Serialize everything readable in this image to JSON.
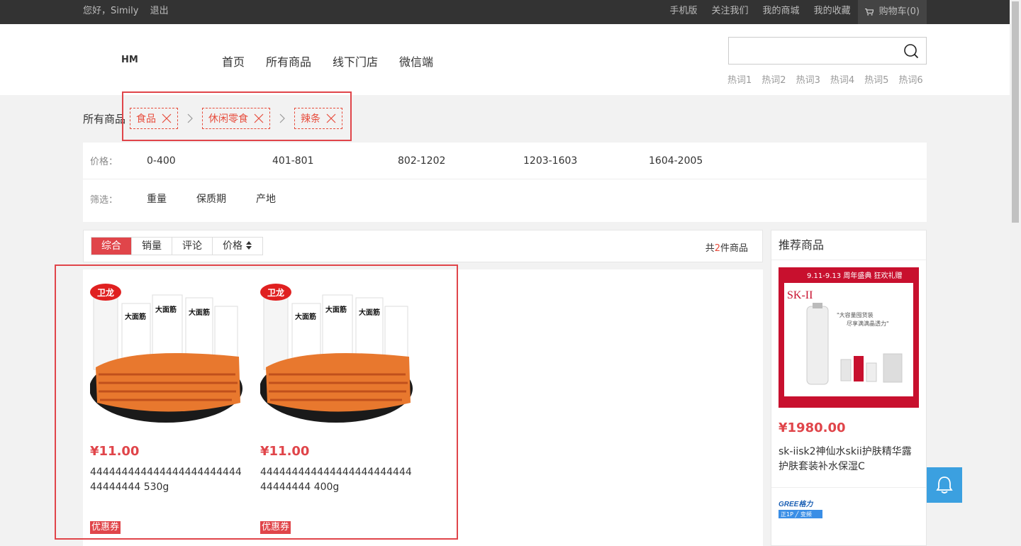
{
  "topbar": {
    "greeting": "您好，Simily",
    "logout": "退出",
    "links": [
      "手机版",
      "关注我们",
      "我的商城",
      "我的收藏"
    ],
    "cart": "购物车(0)"
  },
  "header": {
    "logo": "HM",
    "nav": [
      "首页",
      "所有商品",
      "线下门店",
      "微信端"
    ],
    "search_placeholder": "",
    "hotwords": [
      "热词1",
      "热词2",
      "热词3",
      "热词4",
      "热词5",
      "热词6"
    ]
  },
  "breadcrumb": {
    "root": "所有商品",
    "tags": [
      "食品",
      "休闲零食",
      "辣条"
    ]
  },
  "filter": {
    "price_label": "价格：",
    "prices": [
      "0-400",
      "401-801",
      "802-1202",
      "1203-1603",
      "1604-2005"
    ],
    "select_label": "筛选：",
    "selects": [
      "重量",
      "保质期",
      "产地"
    ]
  },
  "sortbar": {
    "sorts": [
      "综合",
      "销量",
      "评论",
      "价格"
    ],
    "count_prefix": "共",
    "count": "2",
    "count_suffix": "件商品"
  },
  "products": [
    {
      "price": "¥11.00",
      "name": "44444444444444444444444444444444 530g",
      "coupon": "优惠券"
    },
    {
      "price": "¥11.00",
      "name": "44444444444444444444444444444444 400g",
      "coupon": "优惠券"
    }
  ],
  "recommend": {
    "title": "推荐商品",
    "items": [
      {
        "price": "¥1980.00",
        "name": "sk-iisk2神仙水skii护肤精华露护肤套装补水保湿C"
      }
    ]
  },
  "colors": {
    "accent": "#e0454a",
    "topbar": "#333333",
    "chat": "#3ba0e0"
  }
}
